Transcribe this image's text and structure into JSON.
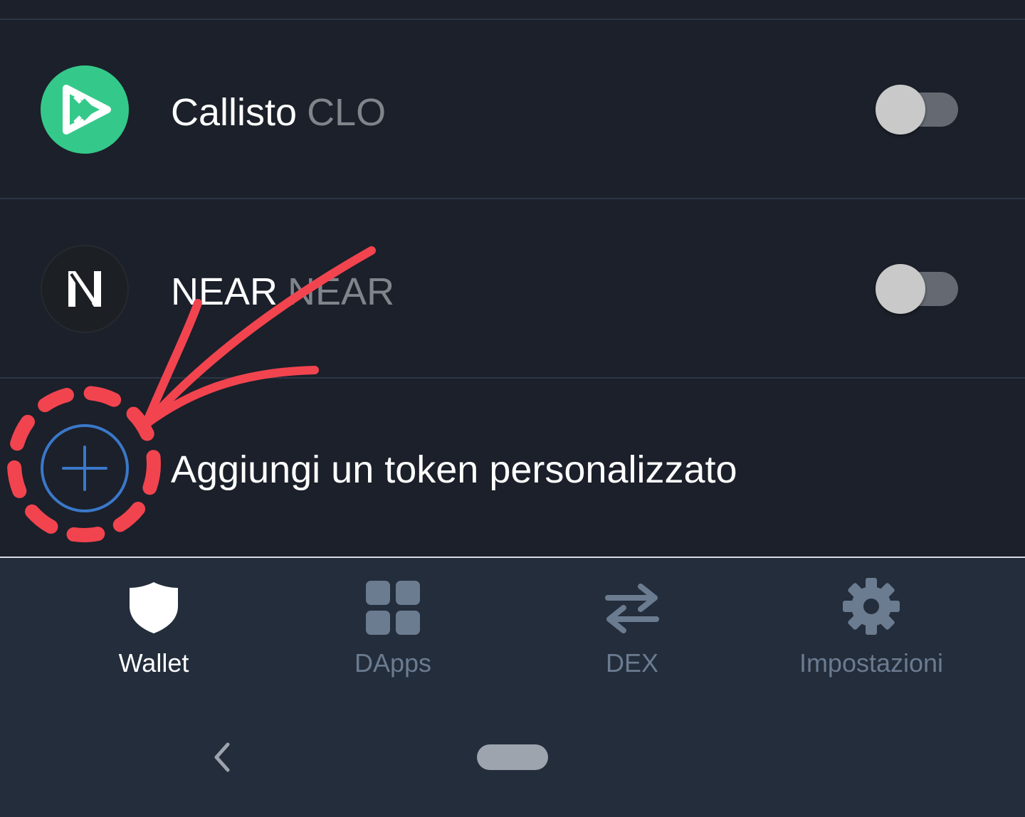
{
  "tokens": [
    {
      "name": "Callisto",
      "symbol": "CLO",
      "icon": "callisto-logo",
      "enabled": false
    },
    {
      "name": "NEAR",
      "symbol": "NEAR",
      "icon": "near-logo",
      "enabled": false
    }
  ],
  "add_custom_token": {
    "label": "Aggiungi un token personalizzato",
    "icon": "plus-circle-icon"
  },
  "bottom_nav": {
    "items": [
      {
        "label": "Wallet",
        "icon": "shield-icon",
        "active": true
      },
      {
        "label": "DApps",
        "icon": "grid-icon",
        "active": false
      },
      {
        "label": "DEX",
        "icon": "swap-arrows-icon",
        "active": false
      },
      {
        "label": "Impostazioni",
        "icon": "gear-icon",
        "active": false
      }
    ]
  },
  "system_nav": {
    "back_icon": "chevron-left-icon",
    "home_icon": "home-pill"
  },
  "colors": {
    "background": "#1b202a",
    "nav_background": "#232d3b",
    "callisto_green": "#34c98a",
    "accent_blue": "#3a78c9",
    "annotation_red": "#f2444f",
    "inactive_label": "#6b7b90"
  }
}
